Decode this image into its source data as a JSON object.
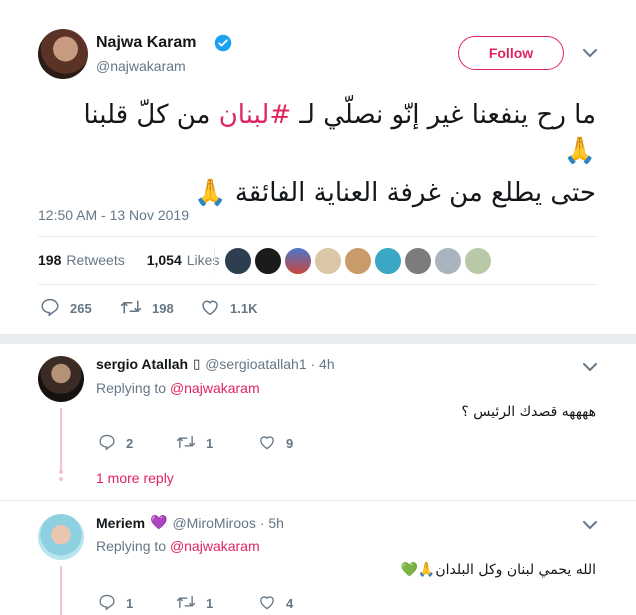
{
  "main_tweet": {
    "author_name": "Najwa Karam",
    "handle": "@najwakaram",
    "follow_label": "Follow",
    "line1_before": "ما رح ينفعنا غير إنّو نصلّي لـ ",
    "hashtag": "#لبنان",
    "line1_after": " من كلّ قلبنا",
    "line2": "حتى يطلع من غرفة العناية الفائقة",
    "prayer_emoji": "🙏",
    "timestamp": "12:50 AM - 13 Nov 2019",
    "retweets_count": "198",
    "retweets_label": "Retweets",
    "likes_count": "1,054",
    "likes_label": "Likes",
    "actions": {
      "replies": "265",
      "retweets": "198",
      "likes": "1.1K"
    }
  },
  "replies": [
    {
      "name": "sergio Atallah",
      "name_symbol": "▯",
      "handle_time": "@sergioatallah1 · 4h",
      "replying_prefix": "Replying to",
      "replying_to": "@najwakaram",
      "text": "ههههه قصدك الرئيس ؟",
      "replies": "2",
      "retweets": "1",
      "likes": "9",
      "more_replies": "1 more reply"
    },
    {
      "name": "Meriem",
      "name_symbol": "💜",
      "handle_time": "@MiroMiroos · 5h",
      "replying_prefix": "Replying to",
      "replying_to": "@najwakaram",
      "text": "الله يحمي لبنان وكل البلدان",
      "emojis": "🙏💚",
      "replies": "1",
      "retweets": "1",
      "likes": "4"
    }
  ],
  "colors": {
    "accent": "#e0245e",
    "verified": "#1da1f2",
    "muted": "#657786",
    "divider": "#e6ecf0"
  },
  "icons": [
    "verified-icon",
    "chevron-down-icon",
    "reply-icon",
    "retweet-icon",
    "heart-icon"
  ]
}
